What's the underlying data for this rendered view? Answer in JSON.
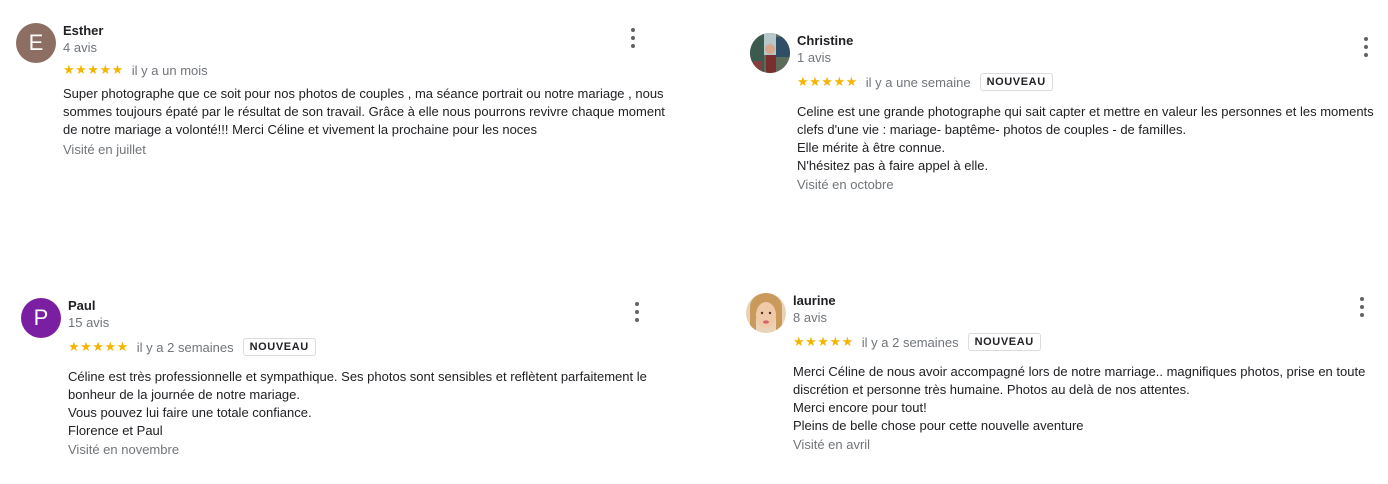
{
  "colors": {
    "star": "#f4b400",
    "avatar_esther": "#8d6e63",
    "avatar_paul": "#7b1fa2"
  },
  "reviews": [
    {
      "initial": "E",
      "name": "Esther",
      "count": "4 avis",
      "stars": "★★★★★",
      "rating": 5,
      "time": "il y a un mois",
      "badge": "",
      "lines": [
        "Super photographe que ce soit pour nos photos de couples , ma séance portrait ou notre mariage , nous",
        "sommes toujours épaté par le résultat de son travail. Grâce à elle nous pourrons revivre chaque moment",
        "de notre mariage a volonté!!! Merci Céline et vivement la prochaine pour les noces"
      ],
      "visited": "Visité en juillet"
    },
    {
      "initial": "",
      "name": "Christine",
      "count": "1 avis",
      "stars": "★★★★★",
      "rating": 5,
      "time": "il y a une semaine",
      "badge": "NOUVEAU",
      "lines": [
        "Celine est une grande photographe qui sait capter et mettre en valeur les personnes et les moments",
        "clefs d'une vie : mariage-  baptême- photos de couples - de familles.",
        "Elle mérite à être connue.",
        "N'hésitez pas à faire appel à elle."
      ],
      "visited": "Visité en octobre"
    },
    {
      "initial": "P",
      "name": "Paul",
      "count": "15 avis",
      "stars": "★★★★★",
      "rating": 5,
      "time": "il y a 2 semaines",
      "badge": "NOUVEAU",
      "lines": [
        "Céline est très professionnelle et sympathique. Ses photos sont sensibles et reflètent parfaitement le",
        "bonheur de la journée de notre mariage.",
        "Vous pouvez lui faire une totale confiance.",
        "Florence et Paul"
      ],
      "visited": "Visité en novembre"
    },
    {
      "initial": "",
      "name": "laurine",
      "count": "8 avis",
      "stars": "★★★★★",
      "rating": 5,
      "time": "il y a 2 semaines",
      "badge": "NOUVEAU",
      "lines": [
        "Merci Céline de nous avoir accompagné lors de notre marriage.. magnifiques photos, prise en toute",
        "discrétion et personne très humaine. Photos au delà de nos attentes.",
        "Merci encore pour tout!",
        "Pleins de belle chose pour cette nouvelle aventure"
      ],
      "visited": "Visité en avril"
    }
  ]
}
